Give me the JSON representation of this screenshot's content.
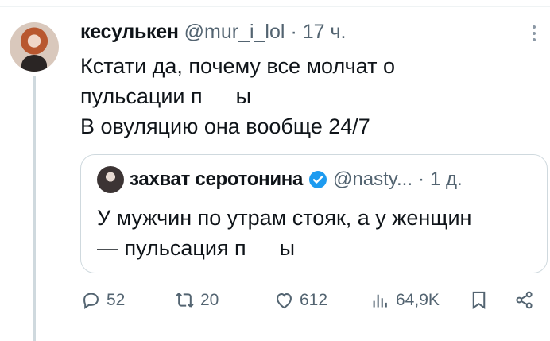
{
  "tweet": {
    "author_name": "кесулькен",
    "author_handle": "@mur_i_lol",
    "separator": "·",
    "time": "17 ч.",
    "lines": [
      "Кстати да, почему все молчат о",
      "пульсации п",
      "ы",
      "В овуляцию она вообще 24/7"
    ]
  },
  "quote": {
    "author_name": "захват серотонина",
    "author_handle": "@nasty...",
    "separator": "·",
    "time": "1 д.",
    "line1": "У мужчин по утрам стояк, а у женщин",
    "line2_start": "— пульсация п",
    "line2_end": "ы"
  },
  "actions": {
    "replies": "52",
    "retweets": "20",
    "likes": "612",
    "views": "64,9K"
  },
  "icons": [
    "more-icon",
    "verified-icon",
    "reply-icon",
    "retweet-icon",
    "like-icon",
    "views-icon",
    "bookmark-icon",
    "share-icon"
  ],
  "colors": {
    "secondary_text": "#536471",
    "verified": "#1d9bf0",
    "border": "#cfd9de"
  }
}
